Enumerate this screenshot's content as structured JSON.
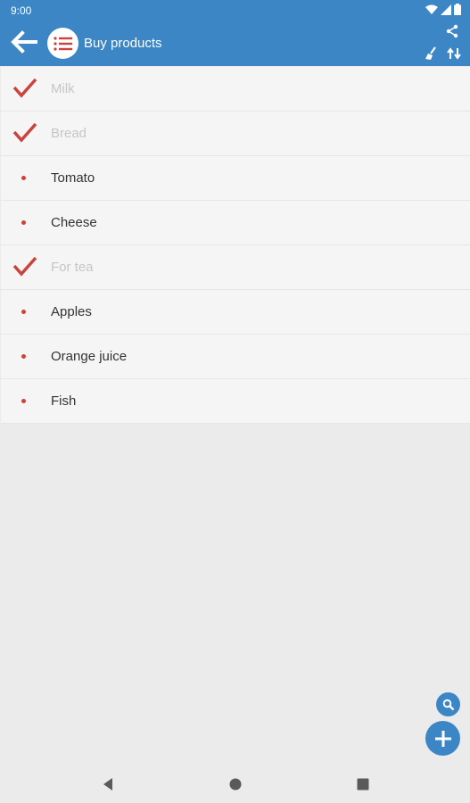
{
  "status_bar": {
    "time": "9:00"
  },
  "app_bar": {
    "title": "Buy products",
    "color": "#3d86c6"
  },
  "icons": {
    "back": "arrow-left-icon",
    "logo": "list-icon",
    "share": "share-icon",
    "clear": "broom-icon",
    "sort": "swap-icon",
    "search": "search-icon",
    "add": "plus-icon"
  },
  "items": [
    {
      "label": "Milk",
      "checked": true
    },
    {
      "label": "Bread",
      "checked": true
    },
    {
      "label": "Tomato",
      "checked": false
    },
    {
      "label": "Cheese",
      "checked": false
    },
    {
      "label": "For tea",
      "checked": true
    },
    {
      "label": "Apples",
      "checked": false
    },
    {
      "label": "Orange juice",
      "checked": false
    },
    {
      "label": "Fish",
      "checked": false
    }
  ],
  "accent_color": "#c8443c"
}
